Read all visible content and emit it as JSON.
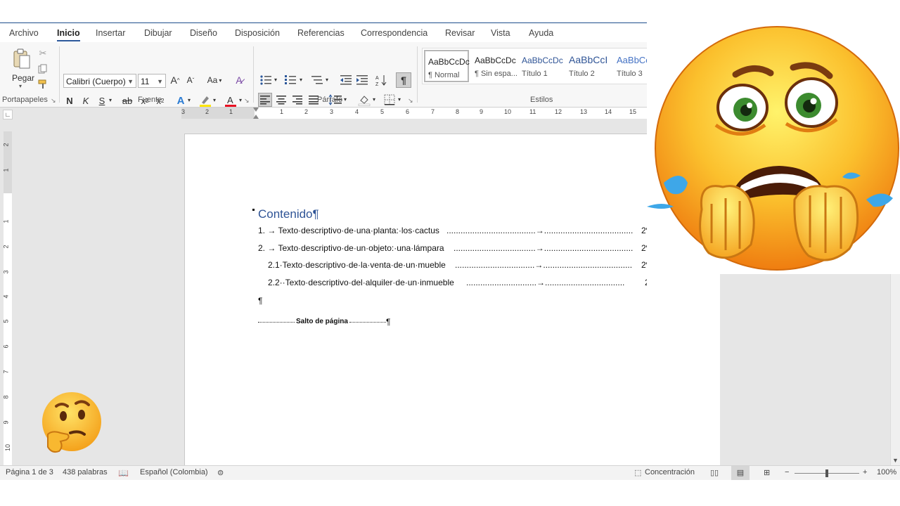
{
  "menu": {
    "items": [
      "Archivo",
      "Inicio",
      "Insertar",
      "Dibujar",
      "Diseño",
      "Disposición",
      "Referencias",
      "Correspondencia",
      "Revisar",
      "Vista",
      "Ayuda"
    ],
    "active_index": 1
  },
  "ribbon": {
    "clipboard": {
      "paste_label": "Pegar",
      "group_label": "Portapapeles"
    },
    "font": {
      "font_name": "Calibri (Cuerpo)",
      "font_size": "11",
      "grow": "A",
      "shrink": "A",
      "case": "Aa",
      "bold": "N",
      "italic": "K",
      "underline": "S",
      "strike": "ab",
      "subscript": "x",
      "superscript": "x",
      "group_label": "Fuente"
    },
    "paragraph": {
      "group_label": "Párrafo",
      "pilcrow": "¶"
    },
    "styles": {
      "group_label": "Estilos",
      "items": [
        {
          "preview": "AaBbCcDc",
          "name": "¶ Normal"
        },
        {
          "preview": "AaBbCcDc",
          "name": "¶ Sin espa..."
        },
        {
          "preview": "AaBbCcDc",
          "name": "Título 1"
        },
        {
          "preview": "AaBbCcI",
          "name": "Título 2"
        },
        {
          "preview": "AaBbCc",
          "name": "Título 3"
        }
      ]
    }
  },
  "ruler": {
    "horizontal": [
      "3",
      "2",
      "1",
      "1",
      "2",
      "3",
      "4",
      "5",
      "6",
      "7",
      "8",
      "9",
      "10",
      "11",
      "12",
      "13",
      "14",
      "15"
    ],
    "vertical": [
      "2",
      "1",
      "1",
      "2",
      "3",
      "4",
      "5",
      "6",
      "7",
      "8",
      "9",
      "10"
    ]
  },
  "document": {
    "toc_title": "Contenido¶",
    "entries": [
      {
        "text": "1. → Texto·descriptivo·de·una·planta:·los·cactus",
        "page": "2¶"
      },
      {
        "text": "2. → Texto·descriptivo·de·un·objeto:·una·lámpara",
        "page": "2¶"
      },
      {
        "text": "2.1·Texto·descriptivo·de·la·venta·de·un·mueble",
        "page": "2¶"
      },
      {
        "text": "2.2··Texto·descriptivo·del·alquiler·de·un·inmueble",
        "page": "2¶"
      }
    ],
    "empty_paragraph": "¶",
    "page_break": "Salto de página",
    "page_break_mark": "¶"
  },
  "status": {
    "page": "Página 1 de 3",
    "words": "438 palabras",
    "language": "Español (Colombia)",
    "focus": "Concentración",
    "zoom": "100%",
    "zoom_minus": "−",
    "zoom_plus": "+"
  },
  "colors": {
    "accent": "#2b579a",
    "heading": "#2f5496",
    "emoji_face": "#f7a21b"
  },
  "icons": [
    "paste-icon",
    "cut-icon",
    "copy-icon",
    "format-painter-icon",
    "clear-format-icon",
    "bullets-icon",
    "numbering-icon",
    "multilevel-icon",
    "decrease-indent-icon",
    "increase-indent-icon",
    "sort-icon",
    "align-left-icon",
    "align-center-icon",
    "align-right-icon",
    "justify-icon",
    "line-spacing-icon",
    "shading-icon",
    "borders-icon",
    "text-effects-icon",
    "highlight-icon",
    "font-color-icon",
    "read-mode-icon",
    "print-layout-icon",
    "web-layout-icon",
    "crying-emoji",
    "thinking-emoji"
  ]
}
